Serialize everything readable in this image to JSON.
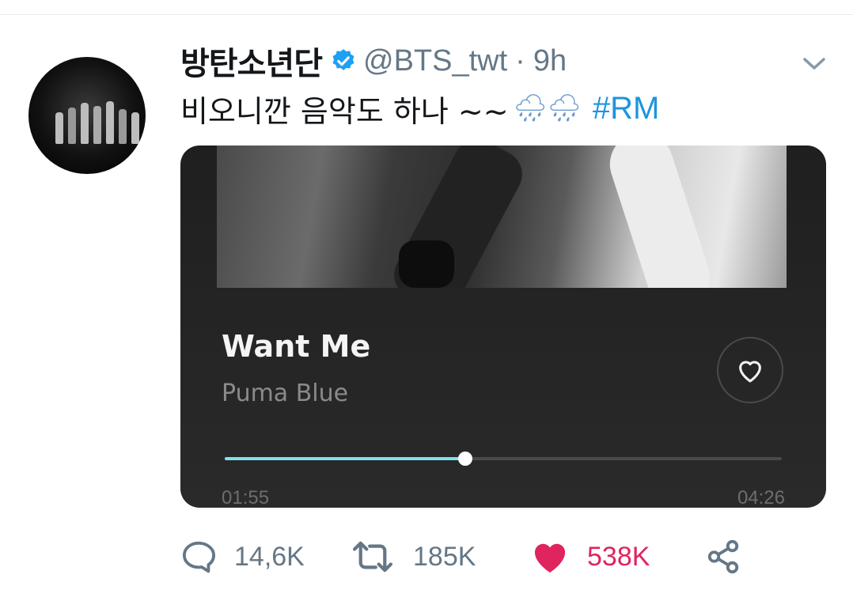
{
  "tweet": {
    "display_name": "방탄소년단",
    "handle": "@BTS_twt",
    "separator": "·",
    "time": "9h",
    "text": "비오니깐 음악도 하나 ~~",
    "emojis": "🌧🌧",
    "hashtag": "#RM"
  },
  "player": {
    "song_title": "Want Me",
    "artist": "Puma Blue",
    "elapsed": "01:55",
    "total": "04:26",
    "progress_fraction": 0.432,
    "accent_color": "#7de3ee"
  },
  "actions": {
    "replies": "14,6K",
    "retweets": "185K",
    "likes": "538K"
  },
  "colors": {
    "like_red": "#e0245e",
    "link_blue": "#1b95e0",
    "verified_blue": "#1da1f2",
    "muted_gray": "#657786"
  },
  "icons": [
    "avatar",
    "verified-badge-icon",
    "chevron-down-icon",
    "heart-outline-icon",
    "reply-icon",
    "retweet-icon",
    "heart-filled-icon",
    "share-icon"
  ]
}
